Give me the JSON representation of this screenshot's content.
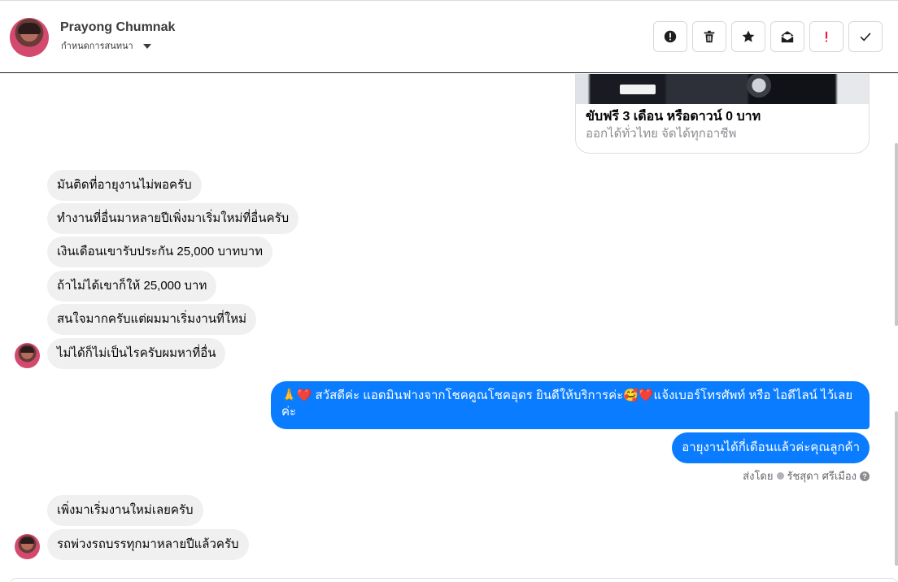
{
  "header": {
    "contact_name": "Prayong Chumnak",
    "assign_label": "กำหนดการสนทนา"
  },
  "actions": [
    {
      "name": "report-button",
      "icon": "alert-circle-icon"
    },
    {
      "name": "delete-button",
      "icon": "trash-icon"
    },
    {
      "name": "star-button",
      "icon": "star-icon"
    },
    {
      "name": "mark-unread-button",
      "icon": "envelope-open-icon"
    },
    {
      "name": "important-button",
      "icon": "exclamation-icon"
    },
    {
      "name": "done-button",
      "icon": "checkmark-icon"
    }
  ],
  "card": {
    "title": "ขับฟรี 3 เดือน หรือดาวน์ 0 บาท",
    "subtitle": "ออกได้ทั่วไทย จัดได้ทุกอาชีพ"
  },
  "messages_in_1": [
    "มันติดที่อายุงานไม่พอครับ",
    "ทำงานที่อื่นมาหลายปีเพิ่งมาเริ่มใหม่ที่อื่นครับ",
    "เงินเดือนเขารับประกัน 25,000 บาทบาท",
    "ถ้าไม่ได้เขาก็ให้ 25,000 บาท",
    "สนใจมากครับแต่ผมมาเริ่มงานที่ใหม่",
    "ไม่ได้ก็ไม่เป็นไรครับผมหาที่อื่น"
  ],
  "messages_out": [
    "🙏❤️ สวัสดีค่ะ แอดมินฟางจากโชคคูณโชคอุดร ยินดีให้บริการค่ะ🥰❤️แจ้งเบอร์โทรศัพท์ หรือ ไอดีไลน์  ไว้เลยค่ะ",
    "อายุงานได้กี่เดือนแล้วค่ะคุณลูกค้า"
  ],
  "sent_by": {
    "prefix": "ส่งโดย",
    "agent": "รัชสุดา ศรีเมือง",
    "help": "?"
  },
  "messages_in_2": [
    "เพิ่งมาเริ่มงานใหม่เลยครับ",
    "รถพ่วงรถบรรทุกมาหลายปีแล้วครับ"
  ],
  "colors": {
    "outgoing_bubble": "#0a7cff",
    "incoming_bubble": "#f0f0f0",
    "important_icon": "#e41e3f"
  }
}
